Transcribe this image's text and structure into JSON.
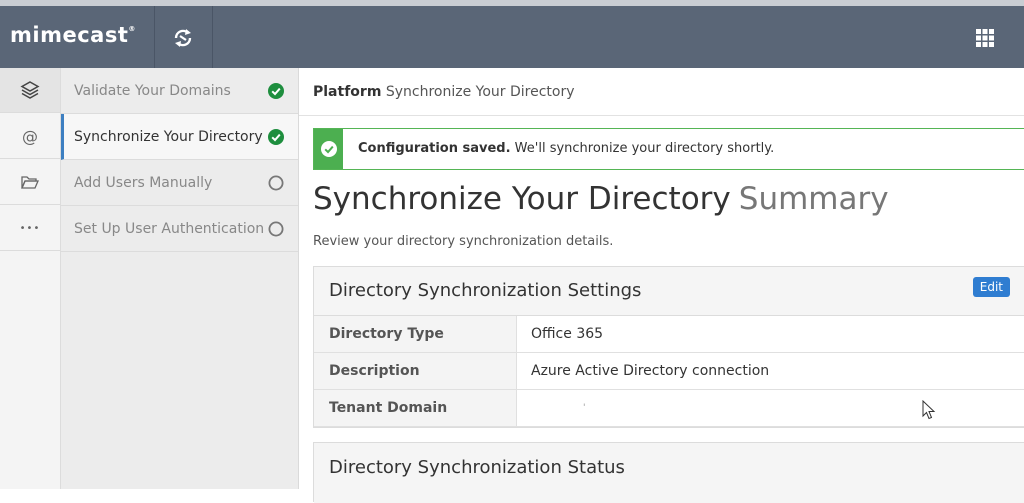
{
  "header": {
    "logo_text": "mimecast",
    "logo_mark": "®",
    "sync_icon": "sync-icon",
    "apps_icon": "grid-apps-icon"
  },
  "rail": {
    "items": [
      {
        "icon": "layers-icon",
        "active": true
      },
      {
        "icon": "at-icon",
        "label": "@"
      },
      {
        "icon": "folder-open-icon"
      },
      {
        "icon": "more-icon",
        "label": "•••"
      }
    ]
  },
  "steps": [
    {
      "label": "Validate Your Domains",
      "status": "complete"
    },
    {
      "label": "Synchronize Your Directory",
      "status": "complete",
      "active": true
    },
    {
      "label": "Add Users Manually",
      "status": "pending"
    },
    {
      "label": "Set Up User Authentication",
      "status": "pending"
    }
  ],
  "breadcrumb": {
    "root": "Platform",
    "current": "Synchronize Your Directory"
  },
  "alert": {
    "strong": "Configuration saved.",
    "text": " We'll synchronize your directory shortly.",
    "color": "#4caf50"
  },
  "page": {
    "title": "Synchronize Your Directory",
    "subtitle": "Summary",
    "description": "Review your directory synchronization details."
  },
  "settings_panel": {
    "title": "Directory Synchronization Settings",
    "edit_label": "Edit",
    "rows": [
      {
        "key": "Directory Type",
        "value": "Office 365"
      },
      {
        "key": "Description",
        "value": "Azure Active Directory connection"
      },
      {
        "key": "Tenant Domain",
        "value": "'"
      }
    ]
  },
  "status_panel": {
    "title": "Directory Synchronization Status"
  },
  "colors": {
    "header_bg": "#5a6677",
    "accent_blue": "#2f7dd1",
    "success_green": "#1e8e3e"
  }
}
